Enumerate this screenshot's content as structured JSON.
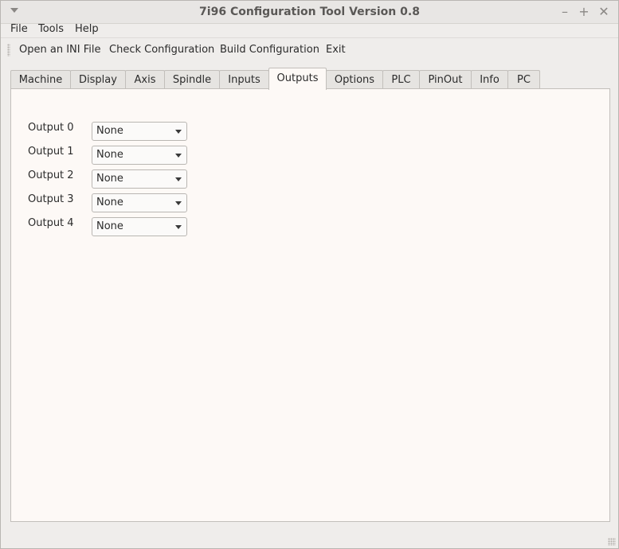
{
  "window": {
    "title": "7i96 Configuration Tool Version 0.8"
  },
  "menubar": {
    "items": [
      "File",
      "Tools",
      "Help"
    ]
  },
  "toolbar": {
    "items": [
      "Open an INI File",
      "Check Configuration",
      "Build Configuration",
      "Exit"
    ]
  },
  "tabs": {
    "items": [
      "Machine",
      "Display",
      "Axis",
      "Spindle",
      "Inputs",
      "Outputs",
      "Options",
      "PLC",
      "PinOut",
      "Info",
      "PC"
    ],
    "active": "Outputs"
  },
  "outputs": [
    {
      "label": "Output 0",
      "value": "None"
    },
    {
      "label": "Output 1",
      "value": "None"
    },
    {
      "label": "Output 2",
      "value": "None"
    },
    {
      "label": "Output 3",
      "value": "None"
    },
    {
      "label": "Output 4",
      "value": "None"
    }
  ],
  "icons": {
    "window_menu": "chevron-down-icon",
    "minimize": "minimize-icon",
    "maximize": "maximize-icon",
    "close": "close-icon",
    "dropdown": "dropdown-arrow-icon"
  }
}
